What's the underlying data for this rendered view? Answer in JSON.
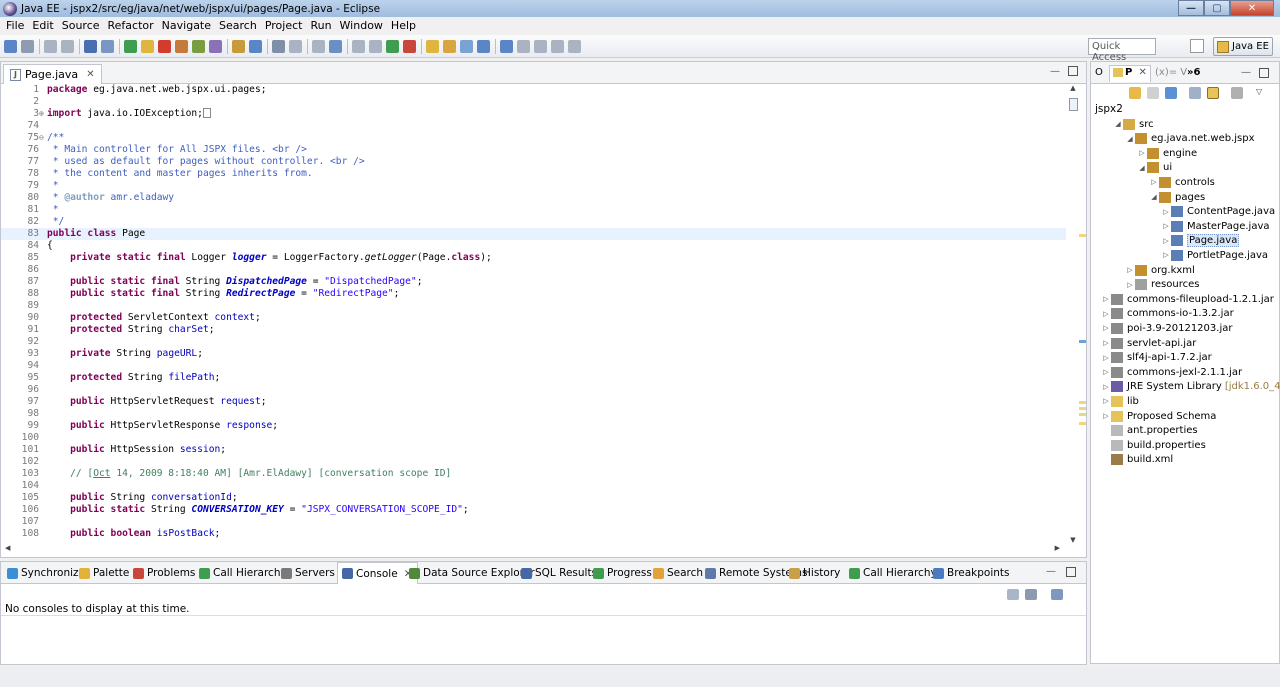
{
  "window": {
    "title": "Java EE - jspx2/src/eg/java/net/web/jspx/ui/pages/Page.java - Eclipse",
    "minimize_label": "—",
    "maximize_label": "▢",
    "close_label": "✕"
  },
  "menu": [
    "File",
    "Edit",
    "Source",
    "Refactor",
    "Navigate",
    "Search",
    "Project",
    "Run",
    "Window",
    "Help"
  ],
  "toolbar": {
    "quick_access_placeholder": "Quick Access",
    "perspective_label": "Java EE"
  },
  "editor": {
    "tab_label": "Page.java",
    "tab_close": "✕",
    "lines": [
      {
        "n": "1",
        "fold": "",
        "html": "<span class=\"kw\">package</span> eg.java.net.web.jspx.ui.pages;"
      },
      {
        "n": "2",
        "fold": "",
        "html": ""
      },
      {
        "n": "3",
        "fold": "⊕",
        "html": "<span class=\"kw\">import</span> java.io.IOException;<span class=\"fbox\"></span>"
      },
      {
        "n": "74",
        "fold": "",
        "html": ""
      },
      {
        "n": "75",
        "fold": "⊖",
        "html": "<span class=\"jd\">/**</span>"
      },
      {
        "n": "76",
        "fold": "",
        "html": "<span class=\"jd\"> * Main controller for All JSPX files. &lt;br /&gt;</span>"
      },
      {
        "n": "77",
        "fold": "",
        "html": "<span class=\"jd\"> * used as default for pages without controller. &lt;br /&gt;</span>"
      },
      {
        "n": "78",
        "fold": "",
        "html": "<span class=\"jd\"> * the content and master pages inherits from.</span>"
      },
      {
        "n": "79",
        "fold": "",
        "html": "<span class=\"jd\"> * </span>"
      },
      {
        "n": "80",
        "fold": "",
        "html": "<span class=\"jd\"> * </span><span class=\"jdt\">@author</span><span class=\"jd\"> amr.eladawy</span>"
      },
      {
        "n": "81",
        "fold": "",
        "html": "<span class=\"jd\"> * </span>"
      },
      {
        "n": "82",
        "fold": "",
        "html": "<span class=\"jd\"> */</span>"
      },
      {
        "n": "83",
        "fold": "",
        "html": "<span class=\"kw\">public class</span> Page",
        "current": true
      },
      {
        "n": "84",
        "fold": "",
        "html": "{"
      },
      {
        "n": "85",
        "fold": "",
        "html": "    <span class=\"kw\">private static final</span> Logger <span class=\"sfld\">logger</span> = LoggerFactory.<span class=\"it\">getLogger</span>(Page.<span class=\"kw\">class</span>);"
      },
      {
        "n": "86",
        "fold": "",
        "html": ""
      },
      {
        "n": "87",
        "fold": "",
        "html": "    <span class=\"kw\">public static final</span> String <span class=\"sfld\">DispatchedPage</span> = <span class=\"str\">\"DispatchedPage\"</span>;"
      },
      {
        "n": "88",
        "fold": "",
        "html": "    <span class=\"kw\">public static final</span> String <span class=\"sfld\">RedirectPage</span> = <span class=\"str\">\"RedirectPage\"</span>;"
      },
      {
        "n": "89",
        "fold": "",
        "html": ""
      },
      {
        "n": "90",
        "fold": "",
        "html": "    <span class=\"kw\">protected</span> ServletContext <span class=\"fld\">context</span>;"
      },
      {
        "n": "91",
        "fold": "",
        "html": "    <span class=\"kw\">protected</span> String <span class=\"fld\">charSet</span>;"
      },
      {
        "n": "92",
        "fold": "",
        "html": ""
      },
      {
        "n": "93",
        "fold": "",
        "html": "    <span class=\"kw\">private</span> String <span class=\"fld\">pageURL</span>;"
      },
      {
        "n": "94",
        "fold": "",
        "html": ""
      },
      {
        "n": "95",
        "fold": "",
        "html": "    <span class=\"kw\">protected</span> String <span class=\"fld\">filePath</span>;"
      },
      {
        "n": "96",
        "fold": "",
        "html": ""
      },
      {
        "n": "97",
        "fold": "",
        "html": "    <span class=\"kw\">public</span> HttpServletRequest <span class=\"fld\">request</span>;"
      },
      {
        "n": "98",
        "fold": "",
        "html": ""
      },
      {
        "n": "99",
        "fold": "",
        "html": "    <span class=\"kw\">public</span> HttpServletResponse <span class=\"fld\">response</span>;"
      },
      {
        "n": "100",
        "fold": "",
        "html": ""
      },
      {
        "n": "101",
        "fold": "",
        "html": "    <span class=\"kw\">public</span> HttpSession <span class=\"fld\">session</span>;"
      },
      {
        "n": "102",
        "fold": "",
        "html": ""
      },
      {
        "n": "103",
        "fold": "",
        "html": "    <span class=\"cm\">// [<u>Oct</u> 14, 2009 8:18:40 AM] [Amr.ElAdawy] [conversation scope ID]</span>"
      },
      {
        "n": "104",
        "fold": "",
        "html": ""
      },
      {
        "n": "105",
        "fold": "",
        "html": "    <span class=\"kw\">public</span> String <span class=\"fld\">conversationId</span>;"
      },
      {
        "n": "106",
        "fold": "",
        "html": "    <span class=\"kw\">public static</span> String <span class=\"sfld\">CONVERSATION_KEY</span> = <span class=\"str\">\"JSPX_CONVERSATION_SCOPE_ID\"</span>;"
      },
      {
        "n": "107",
        "fold": "",
        "html": ""
      },
      {
        "n": "108",
        "fold": "",
        "html": "    <span class=\"kw\">public boolean</span> <span class=\"fld\">isPostBack</span>;"
      }
    ]
  },
  "explorer": {
    "tab_o": "O",
    "tab_p": "P",
    "tab_close": "✕",
    "tab_v": "(x)= V",
    "overflow_label": "»6",
    "root": "jspx2",
    "nodes": [
      {
        "label": "src",
        "depth": 1,
        "tw": "◢",
        "color": "#d7a944"
      },
      {
        "label": "eg.java.net.web.jspx",
        "depth": 2,
        "tw": "◢",
        "color": "#c48f2e"
      },
      {
        "label": "engine",
        "depth": 3,
        "tw": "▷",
        "color": "#c48f2e"
      },
      {
        "label": "ui",
        "depth": 3,
        "tw": "◢",
        "color": "#c48f2e"
      },
      {
        "label": "controls",
        "depth": 4,
        "tw": "▷",
        "color": "#c48f2e"
      },
      {
        "label": "pages",
        "depth": 4,
        "tw": "◢",
        "color": "#c48f2e"
      },
      {
        "label": "ContentPage.java",
        "depth": 5,
        "tw": "▷",
        "color": "#5b7fb5"
      },
      {
        "label": "MasterPage.java",
        "depth": 5,
        "tw": "▷",
        "color": "#5b7fb5"
      },
      {
        "label": "Page.java",
        "depth": 5,
        "tw": "▷",
        "color": "#5b7fb5",
        "selected": true
      },
      {
        "label": "PortletPage.java",
        "depth": 5,
        "tw": "▷",
        "color": "#5b7fb5"
      },
      {
        "label": "org.kxml",
        "depth": 2,
        "tw": "▷",
        "color": "#c48f2e"
      },
      {
        "label": "resources",
        "depth": 2,
        "tw": "▷",
        "color": "#a0a0a0"
      },
      {
        "label": "commons-fileupload-1.2.1.jar",
        "depth": 0,
        "tw": "▷",
        "color": "#8a8a8a"
      },
      {
        "label": "commons-io-1.3.2.jar",
        "depth": 0,
        "tw": "▷",
        "color": "#8a8a8a"
      },
      {
        "label": "poi-3.9-20121203.jar",
        "depth": 0,
        "tw": "▷",
        "color": "#8a8a8a"
      },
      {
        "label": "servlet-api.jar",
        "depth": 0,
        "tw": "▷",
        "color": "#8a8a8a"
      },
      {
        "label": "slf4j-api-1.7.2.jar",
        "depth": 0,
        "tw": "▷",
        "color": "#8a8a8a"
      },
      {
        "label": "commons-jexl-2.1.1.jar",
        "depth": 0,
        "tw": "▷",
        "color": "#8a8a8a"
      },
      {
        "label": "JRE System Library",
        "suffix": "[jdk1.6.0_45]",
        "depth": 0,
        "tw": "▷",
        "color": "#6b5ca5"
      },
      {
        "label": "lib",
        "depth": 0,
        "tw": "▷",
        "color": "#e4c35a"
      },
      {
        "label": "Proposed Schema",
        "depth": 0,
        "tw": "▷",
        "color": "#e4c35a"
      },
      {
        "label": "ant.properties",
        "depth": 0,
        "tw": "",
        "color": "#b9b9b9"
      },
      {
        "label": "build.properties",
        "depth": 0,
        "tw": "",
        "color": "#b9b9b9"
      },
      {
        "label": "build.xml",
        "depth": 0,
        "tw": "",
        "color": "#9c7b4a"
      }
    ]
  },
  "bottom": {
    "tabs": [
      {
        "label": "Synchronize",
        "color": "#3c8fd6"
      },
      {
        "label": "Palette",
        "color": "#e2b23b"
      },
      {
        "label": "Problems",
        "color": "#c9473a"
      },
      {
        "label": "Call Hierarchy",
        "color": "#3f9d4f"
      },
      {
        "label": "Servers",
        "color": "#7a7a7a"
      },
      {
        "label": "Console",
        "color": "#4467a6",
        "active": true
      },
      {
        "label": "Data Source Explorer",
        "color": "#4f8a3a"
      },
      {
        "label": "SQL Results",
        "color": "#4467a6"
      },
      {
        "label": "Progress",
        "color": "#3f9d4f"
      },
      {
        "label": "Search",
        "color": "#e2a23b"
      },
      {
        "label": "Remote Systems",
        "color": "#5d7aa8"
      },
      {
        "label": "History",
        "color": "#c9a04a"
      },
      {
        "label": "Call Hierarchy",
        "color": "#3f9d4f"
      },
      {
        "label": "Breakpoints",
        "color": "#4c7ac0"
      }
    ],
    "console_close": "✕",
    "console_message": "No consoles to display at this time."
  }
}
